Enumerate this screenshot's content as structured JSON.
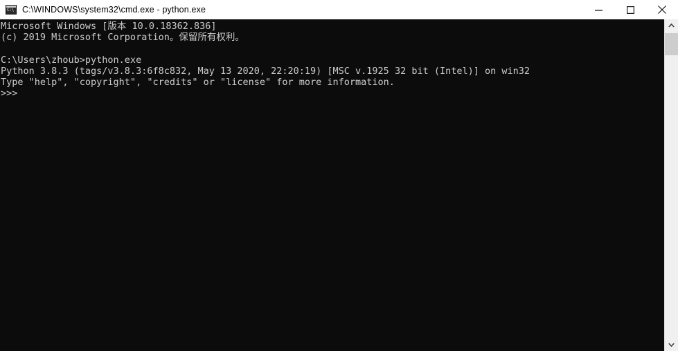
{
  "window": {
    "title": "C:\\WINDOWS\\system32\\cmd.exe - python.exe",
    "icon_label": "C:\\",
    "background_color": "#0c0c0c",
    "text_color": "#cccccc",
    "titlebar_color": "#ffffff"
  },
  "window_controls": {
    "minimize_label": "—",
    "maximize_label": "□",
    "close_label": "✕"
  },
  "console": {
    "lines": [
      "Microsoft Windows [版本 10.0.18362.836]",
      "(c) 2019 Microsoft Corporation。保留所有权利。",
      "",
      "C:\\Users\\zhoub>python.exe",
      "Python 3.8.3 (tags/v3.8.3:6f8c832, May 13 2020, 22:20:19) [MSC v.1925 32 bit (Intel)] on win32",
      "Type \"help\", \"copyright\", \"credits\" or \"license\" for more information.",
      ">>>"
    ],
    "text": "Microsoft Windows [版本 10.0.18362.836]\n(c) 2019 Microsoft Corporation。保留所有权利。\n\nC:\\Users\\zhoub>python.exe\nPython 3.8.3 (tags/v3.8.3:6f8c832, May 13 2020, 22:20:19) [MSC v.1925 32 bit (Intel)] on win32\nType \"help\", \"copyright\", \"credits\" or \"license\" for more information.\n>>>",
    "prompt": ">>>",
    "working_directory": "C:\\Users\\zhoub",
    "command_entered": "python.exe",
    "os_version": "10.0.18362.836",
    "copyright": "(c) 2019 Microsoft Corporation。保留所有权利。",
    "python_version": "3.8.3",
    "python_build": "tags/v3.8.3:6f8c832",
    "python_build_date": "May 13 2020, 22:20:19",
    "python_compiler": "[MSC v.1925 32 bit (Intel)] on win32"
  },
  "scrollbar": {
    "up_arrow": "⌃",
    "down_arrow": "⌄"
  }
}
